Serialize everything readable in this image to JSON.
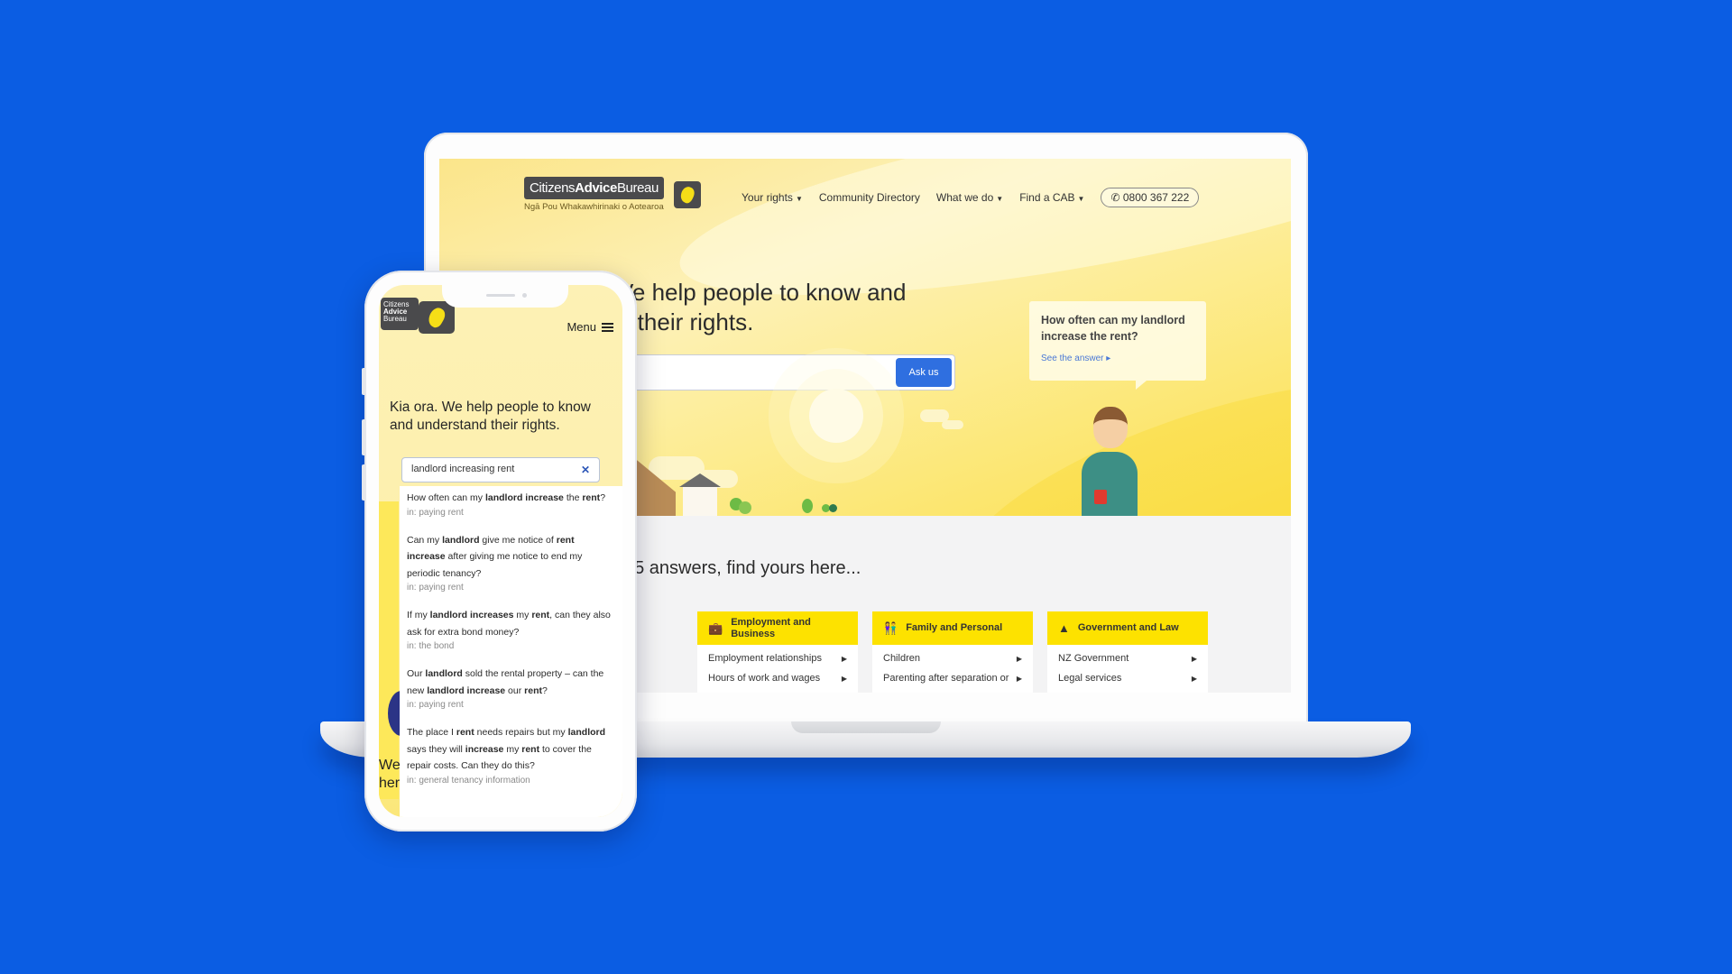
{
  "colors": {
    "background": "#0b5de3",
    "brand_yellow": "#fde200",
    "button_blue": "#2f6fe0",
    "logo_grey": "#4a4a4c"
  },
  "desktop": {
    "logo": {
      "word1": "Citizens",
      "word2": "Advice",
      "word3": "Bureau",
      "subtitle": "Ngā Pou Whakawhirinaki o Aotearoa"
    },
    "nav": [
      {
        "label": "Your rights",
        "dropdown": true
      },
      {
        "label": "Community Directory",
        "dropdown": false
      },
      {
        "label": "What we do",
        "dropdown": true
      },
      {
        "label": "Find a CAB",
        "dropdown": true
      }
    ],
    "phone_number": "0800 367 222",
    "hero": {
      "title": "We help people to know and understand their rights.",
      "title_visible_line1": "Ve help people to know and",
      "title_visible_line2": "d their rights.",
      "search_value": "",
      "ask_button": "Ask us"
    },
    "question_bubble": {
      "question": "How often can my landlord increase the rent?",
      "link": "See the answer"
    },
    "answers_title": "55 answers, find yours here...",
    "answers_title_visible": "55 answers, find yours here...",
    "categories": [
      {
        "title": "",
        "icon": "unknown-icon",
        "items": [
          "",
          ""
        ]
      },
      {
        "title": "Employment and Business",
        "icon": "briefcase-icon",
        "items": [
          "Employment relationships",
          "Hours of work and wages"
        ]
      },
      {
        "title": "Family and Personal",
        "icon": "family-icon",
        "items": [
          "Children",
          "Parenting after separation or"
        ]
      },
      {
        "title": "Government and Law",
        "icon": "government-building-icon",
        "items": [
          "NZ Government",
          "Legal services"
        ]
      }
    ]
  },
  "mobile": {
    "logo": {
      "line1": "Citizens",
      "line2": "Advice",
      "line3": "Bureau"
    },
    "menu_label": "Menu",
    "hero_title": "Kia ora. We help people to know and understand their rights.",
    "search_value": "landlord increasing rent",
    "partial_heading": "We\nhere",
    "suggestions": [
      {
        "html": "How often can my <b>landlord increase</b> the <b>rent</b>?",
        "category": "in: paying rent"
      },
      {
        "html": "Can my <b>landlord</b> give me notice of <b>rent increase</b> after giving me notice to end my periodic tenancy?",
        "category": "in: paying rent"
      },
      {
        "html": "If my <b>landlord increases</b> my <b>rent</b>, can they also ask for extra bond money?",
        "category": "in: the bond"
      },
      {
        "html": "Our <b>landlord</b> sold the rental property – can the new <b>landlord increase</b> our <b>rent</b>?",
        "category": "in: paying rent"
      },
      {
        "html": "The place I <b>rent</b> needs repairs but my <b>landlord</b> says they will <b>increase</b> my <b>rent</b> to cover the repair costs. Can they do this?",
        "category": "in: general tenancy information"
      }
    ]
  }
}
